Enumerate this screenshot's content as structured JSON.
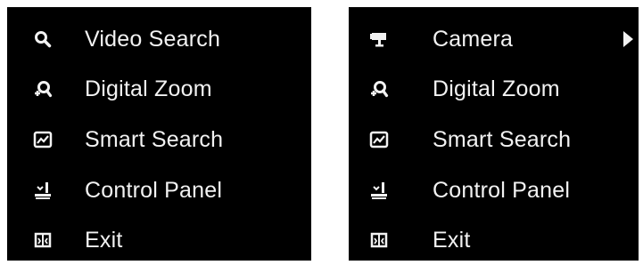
{
  "left_menu": {
    "items": [
      {
        "label": "Video Search",
        "icon": "search-icon"
      },
      {
        "label": "Digital Zoom",
        "icon": "digital-zoom-icon"
      },
      {
        "label": "Smart Search",
        "icon": "smart-search-icon"
      },
      {
        "label": "Control Panel",
        "icon": "control-panel-icon"
      },
      {
        "label": "Exit",
        "icon": "exit-icon"
      }
    ]
  },
  "right_menu": {
    "items": [
      {
        "label": "Camera",
        "icon": "camera-icon",
        "has_submenu": true
      },
      {
        "label": "Digital Zoom",
        "icon": "digital-zoom-icon"
      },
      {
        "label": "Smart Search",
        "icon": "smart-search-icon"
      },
      {
        "label": "Control Panel",
        "icon": "control-panel-icon"
      },
      {
        "label": "Exit",
        "icon": "exit-icon"
      }
    ]
  },
  "colors": {
    "menu_background": "#000000",
    "text": "#f2f2f2",
    "page_background": "#ffffff"
  }
}
